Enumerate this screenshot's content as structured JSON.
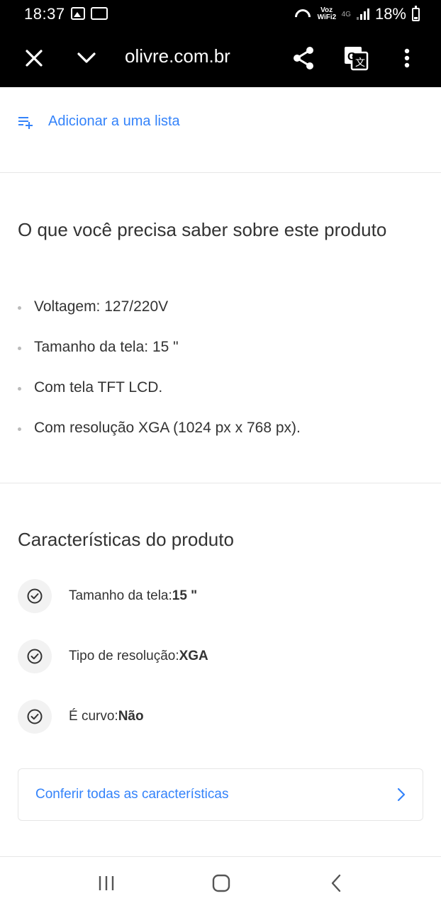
{
  "status_bar": {
    "time": "18:37",
    "network_label": "Voz WiFi2",
    "network_type": "4G",
    "battery": "18%",
    "icons": [
      "gallery-icon",
      "voicemail-icon",
      "wifi-icon",
      "signal-icon",
      "battery-icon"
    ]
  },
  "browser": {
    "url": "olivre.com.br",
    "icons": [
      "close-icon",
      "chevron-down-icon",
      "share-icon",
      "translate-icon",
      "more-vert-icon"
    ]
  },
  "actions": {
    "add_to_list": "Adicionar a uma lista",
    "add_to_list_icon": "playlist-add-icon"
  },
  "about": {
    "title": "O que você precisa saber sobre este produto",
    "items": [
      "Voltagem: 127/220V",
      "Tamanho da tela: 15 \"",
      "Com tela TFT LCD.",
      "Com resolução XGA (1024 px x 768 px)."
    ]
  },
  "characteristics": {
    "title": "Características do produto",
    "items": [
      {
        "label": "Tamanho da tela: ",
        "value": "15 \""
      },
      {
        "label": "Tipo de resolução: ",
        "value": "XGA"
      },
      {
        "label": "É curvo: ",
        "value": "Não"
      }
    ],
    "see_all": "Conferir todas as características"
  },
  "colors": {
    "accent": "#3483fa",
    "text": "#333333",
    "divider": "#e6e6e6",
    "toolbar": "#000000"
  }
}
